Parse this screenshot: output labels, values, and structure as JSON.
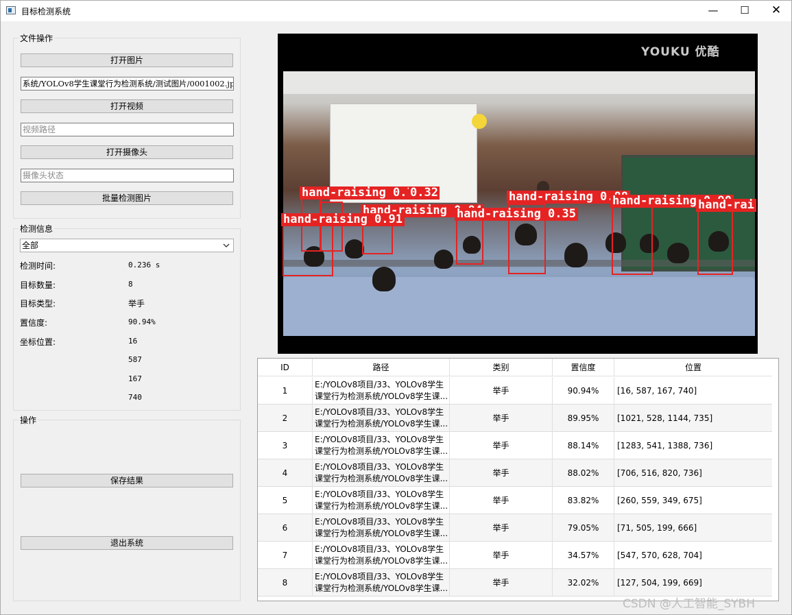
{
  "window": {
    "title": "目标检测系统",
    "minimize": "—",
    "maximize": "☐",
    "close": "✕"
  },
  "file_ops": {
    "title": "文件操作",
    "open_image": "打开图片",
    "image_path": "系统/YOLOv8学生课堂行为检测系统/测试图片/0001002.jpg",
    "open_video": "打开视频",
    "video_path_placeholder": "视频路径",
    "open_camera": "打开摄像头",
    "camera_status_placeholder": "摄像头状态",
    "batch_detect": "批量检测图片"
  },
  "detect_info": {
    "title": "检测信息",
    "filter_selected": "全部",
    "time_label": "检测时间:",
    "time_value": "0.236 s",
    "count_label": "目标数量:",
    "count_value": "8",
    "type_label": "目标类型:",
    "type_value": "举手",
    "conf_label": "置信度:",
    "conf_value": "90.94%",
    "pos_label": "坐标位置:",
    "pos_values": [
      "16",
      "587",
      "167",
      "740"
    ]
  },
  "operations": {
    "title": "操作",
    "save": "保存结果",
    "exit": "退出系统"
  },
  "image": {
    "watermark": "YOUKU 优酷",
    "boxes": [
      {
        "label": "hand-raising 0.79"
      },
      {
        "label": "0.32"
      },
      {
        "label": "hand-raising 0.84"
      },
      {
        "label": "hand-raising 0.88"
      },
      {
        "label": "hand-raising 0.90"
      },
      {
        "label": "hand-rai"
      },
      {
        "label": "hand-raising 0.91"
      },
      {
        "label": "hand-raising 0.35"
      }
    ]
  },
  "table": {
    "headers": [
      "ID",
      "路径",
      "类别",
      "置信度",
      "位置"
    ],
    "rows": [
      {
        "id": "1",
        "path1": "E:/YOLOv8项目/33、YOLOv8学生",
        "path2": "课堂行为检测系统/YOLOv8学生课...",
        "cls": "举手",
        "conf": "90.94%",
        "pos": "[16, 587, 167, 740]"
      },
      {
        "id": "2",
        "path1": "E:/YOLOv8项目/33、YOLOv8学生",
        "path2": "课堂行为检测系统/YOLOv8学生课...",
        "cls": "举手",
        "conf": "89.95%",
        "pos": "[1021, 528, 1144, 735]"
      },
      {
        "id": "3",
        "path1": "E:/YOLOv8项目/33、YOLOv8学生",
        "path2": "课堂行为检测系统/YOLOv8学生课...",
        "cls": "举手",
        "conf": "88.14%",
        "pos": "[1283, 541, 1388, 736]"
      },
      {
        "id": "4",
        "path1": "E:/YOLOv8项目/33、YOLOv8学生",
        "path2": "课堂行为检测系统/YOLOv8学生课...",
        "cls": "举手",
        "conf": "88.02%",
        "pos": "[706, 516, 820, 736]"
      },
      {
        "id": "5",
        "path1": "E:/YOLOv8项目/33、YOLOv8学生",
        "path2": "课堂行为检测系统/YOLOv8学生课...",
        "cls": "举手",
        "conf": "83.82%",
        "pos": "[260, 559, 349, 675]"
      },
      {
        "id": "6",
        "path1": "E:/YOLOv8项目/33、YOLOv8学生",
        "path2": "课堂行为检测系统/YOLOv8学生课...",
        "cls": "举手",
        "conf": "79.05%",
        "pos": "[71, 505, 199, 666]"
      },
      {
        "id": "7",
        "path1": "E:/YOLOv8项目/33、YOLOv8学生",
        "path2": "课堂行为检测系统/YOLOv8学生课...",
        "cls": "举手",
        "conf": "34.57%",
        "pos": "[547, 570, 628, 704]"
      },
      {
        "id": "8",
        "path1": "E:/YOLOv8项目/33、YOLOv8学生",
        "path2": "课堂行为检测系统/YOLOv8学生课...",
        "cls": "举手",
        "conf": "32.02%",
        "pos": "[127, 504, 199, 669]"
      }
    ]
  },
  "watermark_csdn": "CSDN @人工智能_SYBH",
  "colors": {
    "box": "#e52323",
    "background": "#f0f0f0"
  }
}
